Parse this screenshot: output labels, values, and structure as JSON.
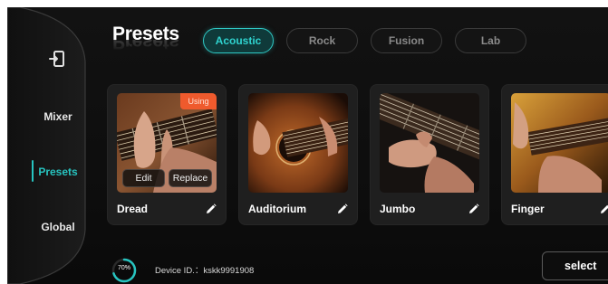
{
  "sidebar": {
    "exit_icon": "exit-icon",
    "items": [
      {
        "label": "Mixer",
        "active": false
      },
      {
        "label": "Presets",
        "active": true
      },
      {
        "label": "Global",
        "active": false
      }
    ]
  },
  "header": {
    "title": "Presets",
    "tabs": [
      {
        "label": "Acoustic",
        "active": true
      },
      {
        "label": "Rock",
        "active": false
      },
      {
        "label": "Fusion",
        "active": false
      },
      {
        "label": "Lab",
        "active": false
      }
    ]
  },
  "presets": [
    {
      "name": "Dread",
      "badge": "Using",
      "actions": {
        "edit": "Edit",
        "replace": "Replace"
      }
    },
    {
      "name": "Auditorium"
    },
    {
      "name": "Jumbo"
    },
    {
      "name": "Finger"
    }
  ],
  "footer": {
    "progress_text": "70%",
    "progress_value": 0.7,
    "device_id": "Device ID.：kskk9991908",
    "select_label": "select"
  },
  "colors": {
    "accent": "#27c4c0",
    "badge": "#ef5a2d",
    "background": "#0d0d0d"
  }
}
